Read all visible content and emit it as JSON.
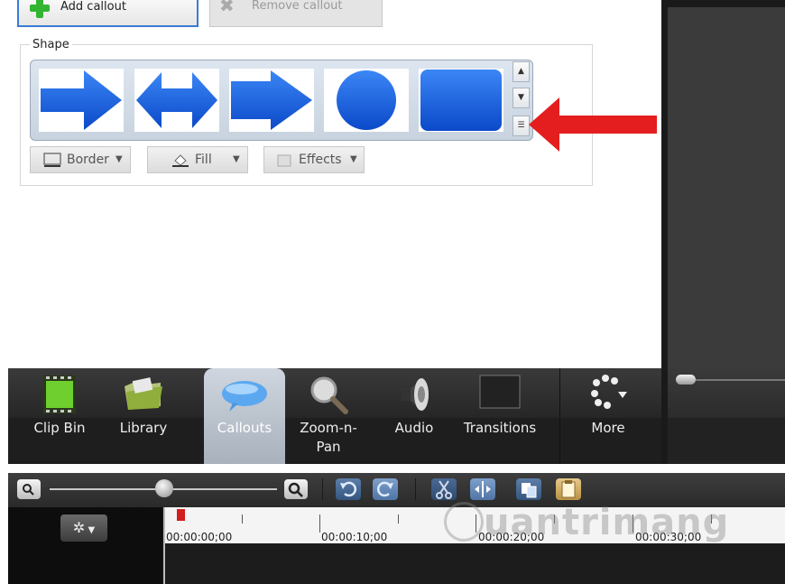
{
  "toolbar": {
    "add_callout": "Add callout",
    "remove_callout": "Remove callout"
  },
  "shape": {
    "legend": "Shape",
    "tiles": [
      "arrow-right",
      "arrow-double",
      "arrow-chevron",
      "circle",
      "rounded-rectangle"
    ],
    "border_label": "Border",
    "fill_label": "Fill",
    "effects_label": "Effects"
  },
  "tabs": [
    {
      "label": "Clip Bin",
      "icon": "filmstrip-icon"
    },
    {
      "label": "Library",
      "icon": "folder-icon"
    },
    {
      "label": "Callouts",
      "icon": "speech-bubble-icon",
      "active": true
    },
    {
      "label": "Zoom-n-\nPan",
      "icon": "magnifier-icon"
    },
    {
      "label": "Audio",
      "icon": "speaker-icon"
    },
    {
      "label": "Transitions",
      "icon": "transition-icon"
    },
    {
      "label": "More",
      "icon": "dots-icon"
    }
  ],
  "timeline": {
    "times": [
      "00:00:00;00",
      "00:00:10;00",
      "00:00:20;00",
      "00:00:30;00"
    ]
  },
  "watermark": "uantrimang",
  "colors": {
    "accent_blue": "#1f63d8",
    "annotation_red": "#e41e1e",
    "tab_active": "#b7c0ca"
  }
}
